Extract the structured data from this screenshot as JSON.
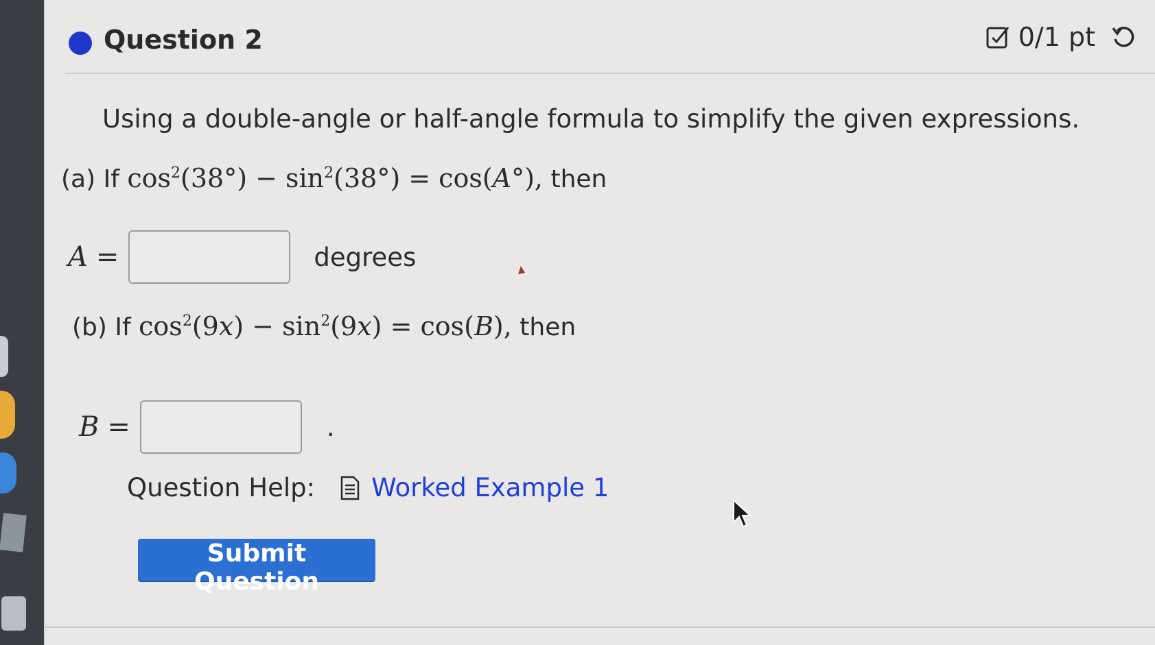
{
  "header": {
    "title": "Question 2",
    "points": "0/1 pt"
  },
  "question": {
    "prompt": "Using a double-angle or half-angle formula to simplify the given expressions.",
    "part_a": {
      "label": "(a) If",
      "expr_pre": "cos",
      "exp1": "2",
      "arg1": "(38°) − sin",
      "exp2": "2",
      "arg2": "(38°) = cos(",
      "var": "A",
      "post": "°),",
      "tail": "then"
    },
    "answer_a": {
      "var": "A",
      "eq": "=",
      "value": "",
      "unit": "degrees"
    },
    "part_b": {
      "label": "(b) If",
      "expr_pre": "cos",
      "exp1": "2",
      "arg1a": "(9",
      "x1": "x",
      "arg1b": ") − sin",
      "exp2": "2",
      "arg2a": "(9",
      "x2": "x",
      "arg2b": ") = cos(",
      "var": "B",
      "post": "),",
      "tail": "then"
    },
    "answer_b": {
      "var": "B",
      "eq": "=",
      "value": "",
      "suffix": "."
    }
  },
  "help": {
    "label": "Question Help:",
    "link_text": "Worked Example 1"
  },
  "submit": {
    "label": "Submit Question"
  },
  "colors": {
    "accent": "#2a6fd1",
    "link": "#1f3fd6",
    "status_dot": "#1e38c9"
  }
}
